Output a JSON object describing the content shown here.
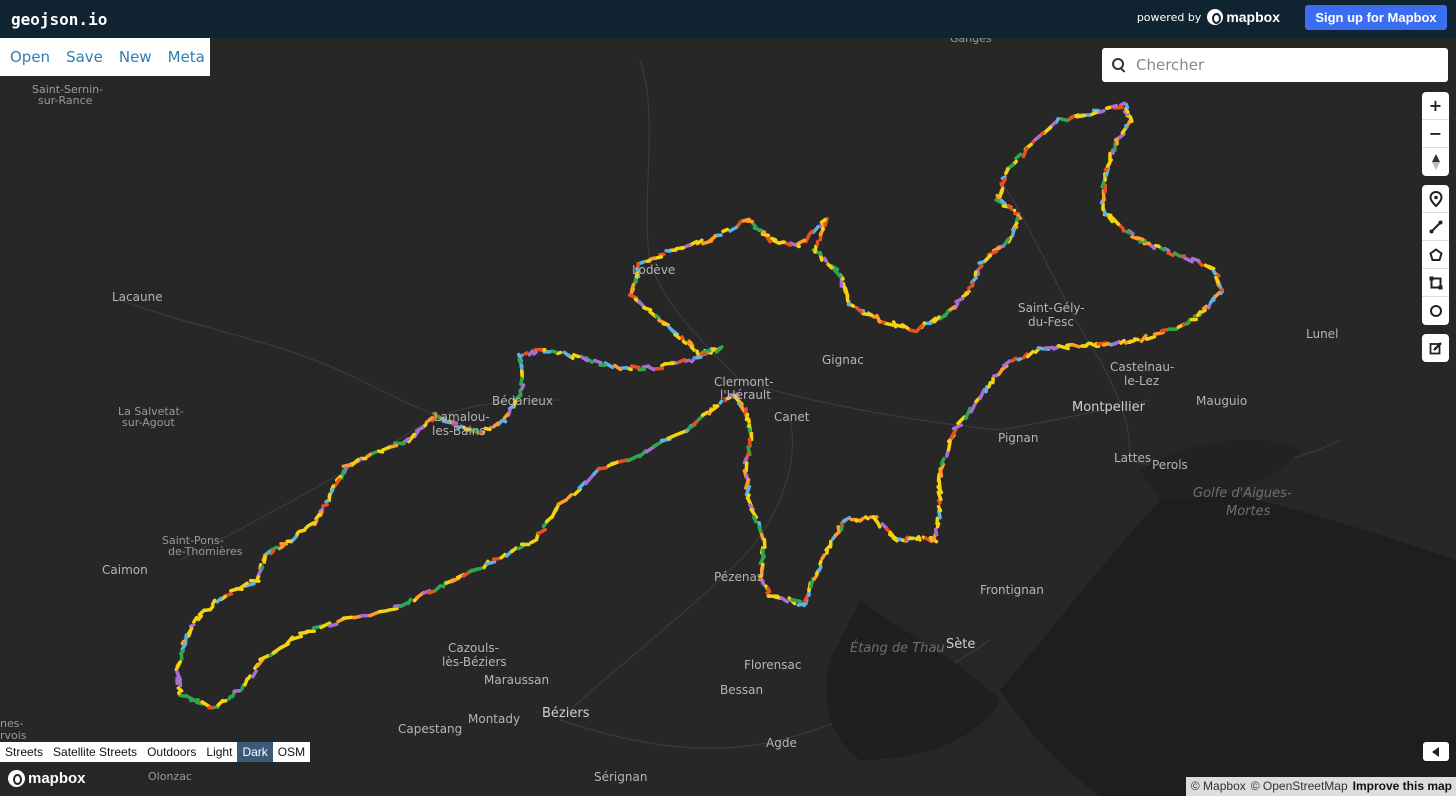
{
  "header": {
    "logo": "geojson.io",
    "powered_by": "powered by",
    "mapbox_word": "mapbox",
    "signup_label": "Sign up for Mapbox"
  },
  "menu": {
    "items": [
      "Open",
      "Save",
      "New",
      "Meta"
    ]
  },
  "search": {
    "placeholder": "Chercher"
  },
  "map_controls": {
    "zoom_in": "+",
    "zoom_out": "−",
    "compass": "▲",
    "draw_point": "marker-icon",
    "draw_line": "line-icon",
    "draw_polygon": "polygon-icon",
    "draw_rectangle": "rectangle-icon",
    "draw_circle": "circle-icon",
    "edit": "edit-icon"
  },
  "map_labels": [
    {
      "text": "Ganges",
      "cls": "lbl"
    },
    {
      "text": "Saint-Sernin-",
      "cls": "lbl"
    },
    {
      "text": "sur-Rance",
      "cls": "lbl"
    },
    {
      "text": "Lacaune",
      "cls": "lbl2"
    },
    {
      "text": "La Salvetat-",
      "cls": "lbl"
    },
    {
      "text": "sur-Agout",
      "cls": "lbl"
    },
    {
      "text": "Saint-Pons-",
      "cls": "lbl"
    },
    {
      "text": "de-Thomières",
      "cls": "lbl"
    },
    {
      "text": "Caimon",
      "cls": "lbl2"
    },
    {
      "text": "Lodève",
      "cls": "lbl2"
    },
    {
      "text": "Bédarieux",
      "cls": "lbl2"
    },
    {
      "text": "Lamalou-",
      "cls": "lbl2"
    },
    {
      "text": "les-Bains",
      "cls": "lbl2"
    },
    {
      "text": "Clermont-",
      "cls": "lbl2"
    },
    {
      "text": "l'Hérault",
      "cls": "lbl2"
    },
    {
      "text": "Gignac",
      "cls": "lbl2"
    },
    {
      "text": "Canet",
      "cls": "lbl2"
    },
    {
      "text": "Saint-Gély-",
      "cls": "lbl2"
    },
    {
      "text": "du-Fesc",
      "cls": "lbl2"
    },
    {
      "text": "Castelnau-",
      "cls": "lbl2"
    },
    {
      "text": "le-Lez",
      "cls": "lbl2"
    },
    {
      "text": "Lunel",
      "cls": "lbl2"
    },
    {
      "text": "Montpellier",
      "cls": "lbl3"
    },
    {
      "text": "Mauguio",
      "cls": "lbl2"
    },
    {
      "text": "Pignan",
      "cls": "lbl2"
    },
    {
      "text": "Lattes",
      "cls": "lbl2"
    },
    {
      "text": "Perols",
      "cls": "lbl2"
    },
    {
      "text": "Pézenas",
      "cls": "lbl2"
    },
    {
      "text": "Frontignan",
      "cls": "lbl2"
    },
    {
      "text": "Sète",
      "cls": "lbl3"
    },
    {
      "text": "Cazouls-",
      "cls": "lbl2"
    },
    {
      "text": "lès-Béziers",
      "cls": "lbl2"
    },
    {
      "text": "Maraussan",
      "cls": "lbl2"
    },
    {
      "text": "Florensac",
      "cls": "lbl2"
    },
    {
      "text": "Bessan",
      "cls": "lbl2"
    },
    {
      "text": "Béziers",
      "cls": "lbl3"
    },
    {
      "text": "Montady",
      "cls": "lbl2"
    },
    {
      "text": "Capestang",
      "cls": "lbl2"
    },
    {
      "text": "Agde",
      "cls": "lbl2"
    },
    {
      "text": "Olonzac",
      "cls": "lbl"
    },
    {
      "text": "Sérignan",
      "cls": "lbl2"
    },
    {
      "text": "Étang de Thau",
      "cls": "water"
    },
    {
      "text": "Golfe d'Aigues-",
      "cls": "water"
    },
    {
      "text": "Mortes",
      "cls": "water"
    },
    {
      "text": "nes-",
      "cls": "lbl"
    },
    {
      "text": "rvois",
      "cls": "lbl"
    }
  ],
  "style_switcher": {
    "items": [
      "Streets",
      "Satellite Streets",
      "Outdoors",
      "Light",
      "Dark",
      "OSM"
    ],
    "active": "Dark"
  },
  "footer": {
    "mapbox_logo": "mapbox",
    "attribution_mapbox": "© Mapbox",
    "attribution_osm": "© OpenStreetMap",
    "improve": "Improve this map"
  },
  "route_colors": [
    "#f5d40f",
    "#f5d40f",
    "#5ab4e5",
    "#2ea84f",
    "#e8511f",
    "#a66fd1",
    "#f5d40f",
    "#ff9c2a"
  ]
}
